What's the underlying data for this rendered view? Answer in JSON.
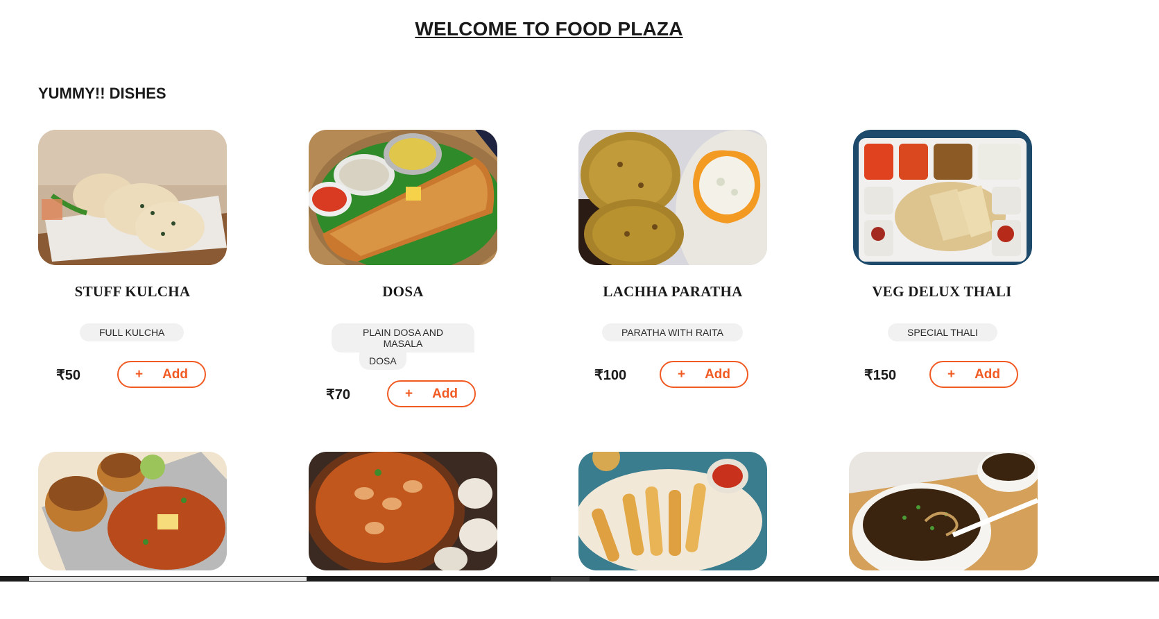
{
  "header": {
    "title": "WELCOME TO FOOD PLAZA"
  },
  "section": {
    "title": "YUMMY!! DISHES"
  },
  "dishes": [
    {
      "name": "STUFF KULCHA",
      "description": "FULL KULCHA",
      "price": "₹50",
      "add_plus": "+",
      "add_label": "Add"
    },
    {
      "name": "DOSA",
      "description_line1": "PLAIN DOSA AND MASALA",
      "description_line2": "DOSA",
      "price": "₹70",
      "add_plus": "+",
      "add_label": "Add"
    },
    {
      "name": "LACHHA PARATHA",
      "description": "PARATHA WITH RAITA",
      "price": "₹100",
      "add_plus": "+",
      "add_label": "Add"
    },
    {
      "name": "VEG DELUX THALI",
      "description": "SPECIAL THALI",
      "price": "₹150",
      "add_plus": "+",
      "add_label": "Add"
    }
  ],
  "colors": {
    "accent": "#f15a22",
    "tag_bg": "#f1f1f1",
    "text": "#1a1a1a"
  },
  "row2_images": [
    "pav-bhaji-image",
    "mushroom-curry-image",
    "spring-rolls-image",
    "soup-image"
  ]
}
